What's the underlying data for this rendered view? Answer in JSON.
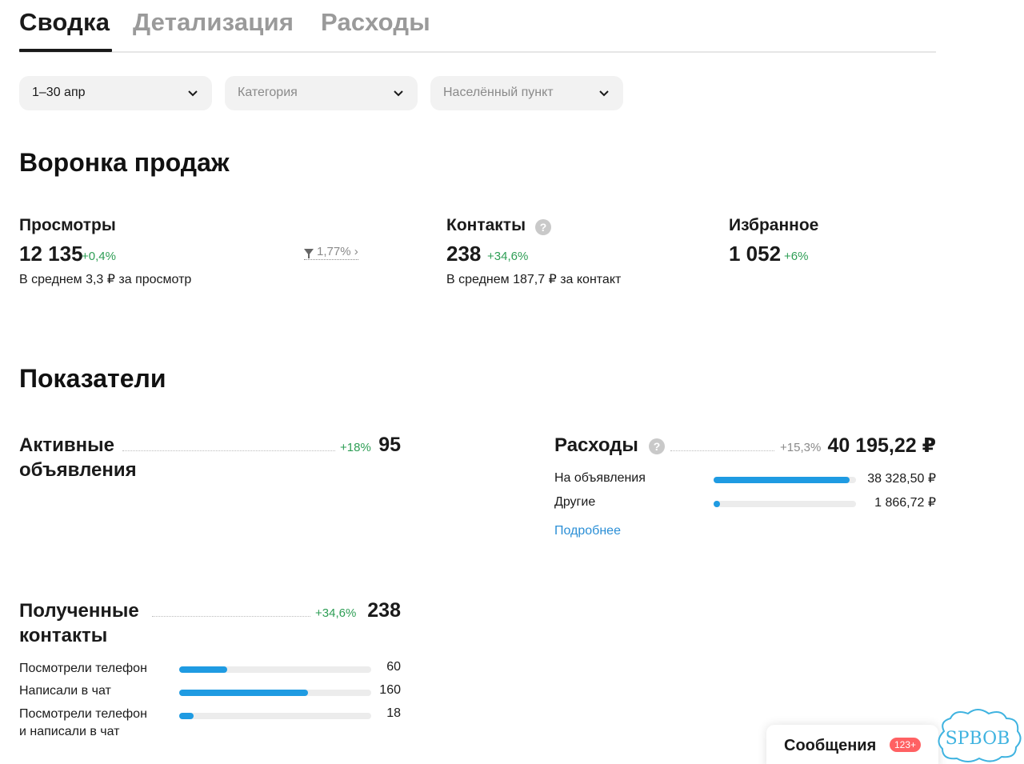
{
  "tabs": [
    {
      "label": "Сводка",
      "active": true
    },
    {
      "label": "Детализация",
      "active": false
    },
    {
      "label": "Расходы",
      "active": false
    }
  ],
  "filters": {
    "period": {
      "value": "1–30 апр"
    },
    "category": {
      "placeholder": "Категория"
    },
    "location": {
      "placeholder": "Населённый пункт"
    }
  },
  "funnel": {
    "title": "Воронка продаж",
    "views": {
      "title": "Просмотры",
      "value": "12 135",
      "delta": "+0,4%",
      "sub": "В среднем 3,3 ₽ за просмотр",
      "conversion": "1,77%"
    },
    "contacts": {
      "title": "Контакты",
      "value": "238",
      "delta": "+34,6%",
      "sub": "В среднем 187,7 ₽ за контакт"
    },
    "favorites": {
      "title": "Избранное",
      "value": "1 052",
      "delta": "+6%"
    }
  },
  "indicators": {
    "title": "Показатели",
    "active_ads": {
      "title_line1": "Активные",
      "title_line2": "объявления",
      "delta": "+18%",
      "value": "95"
    },
    "expenses": {
      "title": "Расходы",
      "delta": "+15,3%",
      "value": "40 195,22 ₽",
      "rows": [
        {
          "label": "На объявления",
          "value": "38 328,50 ₽",
          "share": 0.953
        },
        {
          "label": "Другие",
          "value": "1 866,72 ₽",
          "share": 0.047
        }
      ],
      "more_link": "Подробнее"
    },
    "contacts": {
      "title_line1": "Полученные",
      "title_line2": "контакты",
      "delta": "+34,6%",
      "value": "238",
      "rows": [
        {
          "label_line1": "Посмотрели телефон",
          "label_line2": "",
          "value": "60",
          "fraction": 0.252
        },
        {
          "label_line1": "Написали в чат",
          "label_line2": "",
          "value": "160",
          "fraction": 0.672
        },
        {
          "label_line1": "Посмотрели телефон",
          "label_line2": "и написали в чат",
          "value": "18",
          "fraction": 0.076
        }
      ]
    }
  },
  "messages": {
    "label": "Сообщения",
    "badge": "123+"
  },
  "watermark": {
    "text": "SPBOB"
  },
  "colors": {
    "accent": "#1f9be2",
    "positive": "#2e9e55",
    "badge": "#ff6163",
    "link": "#2b8fd6"
  }
}
